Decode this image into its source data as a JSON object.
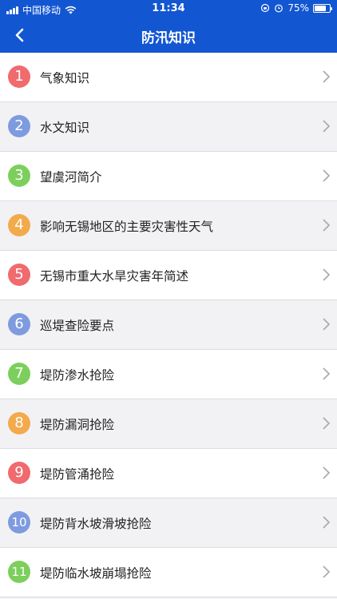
{
  "status_bar": {
    "carrier": "中国移动",
    "time": "11:34",
    "battery": "75%",
    "battery_level": 0.75
  },
  "nav": {
    "title": "防汛知识",
    "back_icon": "chevron-left-icon"
  },
  "colors": {
    "header": "#1356d2",
    "red": "#f06a6e",
    "blue": "#7e9be0",
    "green": "#7ccf5c",
    "orange": "#f3aa4c"
  },
  "items": [
    {
      "num": "1",
      "label": "气象知识",
      "color": "#f06a6e"
    },
    {
      "num": "2",
      "label": "水文知识",
      "color": "#7e9be0"
    },
    {
      "num": "3",
      "label": "望虞河简介",
      "color": "#7ccf5c"
    },
    {
      "num": "4",
      "label": "影响无锡地区的主要灾害性天气",
      "color": "#f3aa4c"
    },
    {
      "num": "5",
      "label": "无锡市重大水旱灾害年简述",
      "color": "#f06a6e"
    },
    {
      "num": "6",
      "label": "巡堤查险要点",
      "color": "#7e9be0"
    },
    {
      "num": "7",
      "label": "堤防渗水抢险",
      "color": "#7ccf5c"
    },
    {
      "num": "8",
      "label": "堤防漏洞抢险",
      "color": "#f3aa4c"
    },
    {
      "num": "9",
      "label": "堤防管涌抢险",
      "color": "#f06a6e"
    },
    {
      "num": "10",
      "label": "堤防背水坡滑坡抢险",
      "color": "#7e9be0"
    },
    {
      "num": "11",
      "label": "堤防临水坡崩塌抢险",
      "color": "#7ccf5c"
    }
  ]
}
